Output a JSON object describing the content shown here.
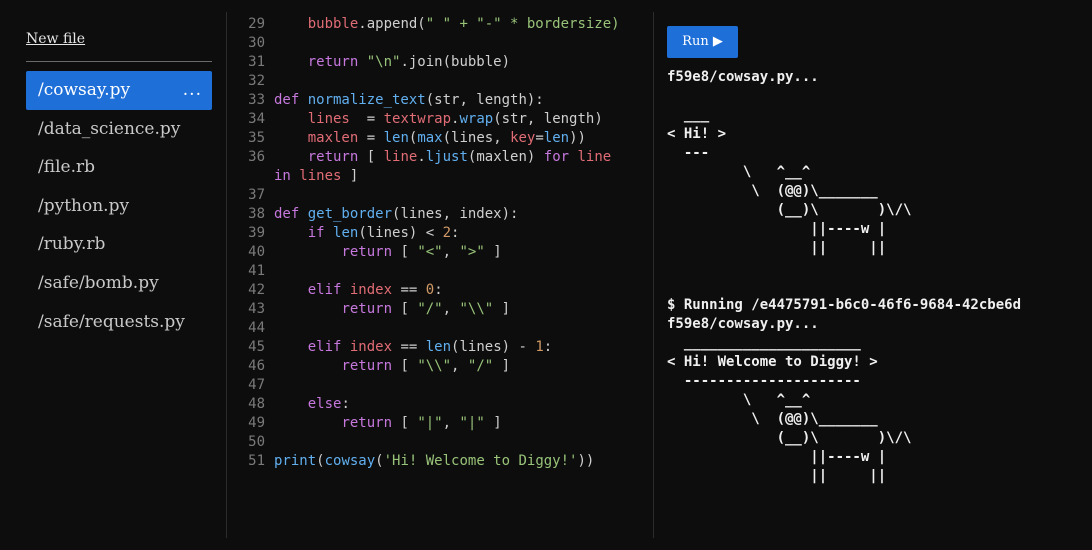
{
  "sidebar": {
    "new_file_label": "New file",
    "items": [
      {
        "label": "/cowsay.py",
        "active": true,
        "more": "..."
      },
      {
        "label": "/data_science.py"
      },
      {
        "label": "/file.rb"
      },
      {
        "label": "/python.py"
      },
      {
        "label": "/ruby.rb"
      },
      {
        "label": "/safe/bomb.py"
      },
      {
        "label": "/safe/requests.py"
      }
    ]
  },
  "editor": {
    "lines": [
      {
        "n": "29",
        "tokens": [
          [
            "    ",
            "op"
          ],
          [
            "bubble",
            "var"
          ],
          [
            ".append(",
            "op"
          ],
          [
            "\" \" + \"-\" * bordersize)",
            "str"
          ]
        ]
      },
      {
        "n": "30",
        "tokens": []
      },
      {
        "n": "31",
        "tokens": [
          [
            "    ",
            "op"
          ],
          [
            "return ",
            "kw"
          ],
          [
            "\"\\n\"",
            "str"
          ],
          [
            ".join(bubble)",
            "op"
          ]
        ]
      },
      {
        "n": "32",
        "tokens": []
      },
      {
        "n": "33",
        "tokens": [
          [
            "def ",
            "kw"
          ],
          [
            "normalize_text",
            "fn"
          ],
          [
            "(str, length):",
            "op"
          ]
        ]
      },
      {
        "n": "34",
        "tokens": [
          [
            "    ",
            "op"
          ],
          [
            "lines",
            "var"
          ],
          [
            "  = ",
            "op"
          ],
          [
            "textwrap",
            "var"
          ],
          [
            ".",
            "op"
          ],
          [
            "wrap",
            "fn"
          ],
          [
            "(str, length)",
            "op"
          ]
        ]
      },
      {
        "n": "35",
        "tokens": [
          [
            "    ",
            "op"
          ],
          [
            "maxlen",
            "var"
          ],
          [
            " = ",
            "op"
          ],
          [
            "len",
            "fn"
          ],
          [
            "(",
            "op"
          ],
          [
            "max",
            "fn"
          ],
          [
            "(lines, ",
            "op"
          ],
          [
            "key",
            "var"
          ],
          [
            "=",
            "op"
          ],
          [
            "len",
            "fn"
          ],
          [
            "))",
            "op"
          ]
        ]
      },
      {
        "n": "36",
        "tokens": [
          [
            "    ",
            "op"
          ],
          [
            "return ",
            "kw"
          ],
          [
            "[ ",
            "op"
          ],
          [
            "line",
            "var"
          ],
          [
            ".",
            "op"
          ],
          [
            "ljust",
            "fn"
          ],
          [
            "(maxlen) ",
            "op"
          ],
          [
            "for ",
            "kw"
          ],
          [
            "line",
            "var"
          ]
        ]
      },
      {
        "n": "",
        "tokens": [
          [
            "in ",
            "kw"
          ],
          [
            "lines",
            "var"
          ],
          [
            " ]",
            "op"
          ]
        ]
      },
      {
        "n": "37",
        "tokens": []
      },
      {
        "n": "38",
        "tokens": [
          [
            "def ",
            "kw"
          ],
          [
            "get_border",
            "fn"
          ],
          [
            "(lines, index):",
            "op"
          ]
        ]
      },
      {
        "n": "39",
        "tokens": [
          [
            "    ",
            "op"
          ],
          [
            "if ",
            "kw"
          ],
          [
            "len",
            "fn"
          ],
          [
            "(lines) < ",
            "op"
          ],
          [
            "2",
            "num"
          ],
          [
            ":",
            "op"
          ]
        ]
      },
      {
        "n": "40",
        "tokens": [
          [
            "        ",
            "op"
          ],
          [
            "return ",
            "kw"
          ],
          [
            "[ ",
            "op"
          ],
          [
            "\"<\"",
            "str"
          ],
          [
            ", ",
            "op"
          ],
          [
            "\">\"",
            "str"
          ],
          [
            " ]",
            "op"
          ]
        ]
      },
      {
        "n": "41",
        "tokens": []
      },
      {
        "n": "42",
        "tokens": [
          [
            "    ",
            "op"
          ],
          [
            "elif ",
            "kw"
          ],
          [
            "index",
            "var"
          ],
          [
            " == ",
            "op"
          ],
          [
            "0",
            "num"
          ],
          [
            ":",
            "op"
          ]
        ]
      },
      {
        "n": "43",
        "tokens": [
          [
            "        ",
            "op"
          ],
          [
            "return ",
            "kw"
          ],
          [
            "[ ",
            "op"
          ],
          [
            "\"/\"",
            "str"
          ],
          [
            ", ",
            "op"
          ],
          [
            "\"\\\\\"",
            "str"
          ],
          [
            " ]",
            "op"
          ]
        ]
      },
      {
        "n": "44",
        "tokens": []
      },
      {
        "n": "45",
        "tokens": [
          [
            "    ",
            "op"
          ],
          [
            "elif ",
            "kw"
          ],
          [
            "index",
            "var"
          ],
          [
            " == ",
            "op"
          ],
          [
            "len",
            "fn"
          ],
          [
            "(lines) - ",
            "op"
          ],
          [
            "1",
            "num"
          ],
          [
            ":",
            "op"
          ]
        ]
      },
      {
        "n": "46",
        "tokens": [
          [
            "        ",
            "op"
          ],
          [
            "return ",
            "kw"
          ],
          [
            "[ ",
            "op"
          ],
          [
            "\"\\\\\"",
            "str"
          ],
          [
            ", ",
            "op"
          ],
          [
            "\"/\"",
            "str"
          ],
          [
            " ]",
            "op"
          ]
        ]
      },
      {
        "n": "47",
        "tokens": []
      },
      {
        "n": "48",
        "tokens": [
          [
            "    ",
            "op"
          ],
          [
            "else",
            "kw"
          ],
          [
            ":",
            "op"
          ]
        ]
      },
      {
        "n": "49",
        "tokens": [
          [
            "        ",
            "op"
          ],
          [
            "return ",
            "kw"
          ],
          [
            "[ ",
            "op"
          ],
          [
            "\"|\"",
            "str"
          ],
          [
            ", ",
            "op"
          ],
          [
            "\"|\"",
            "str"
          ],
          [
            " ]",
            "op"
          ]
        ]
      },
      {
        "n": "50",
        "tokens": []
      },
      {
        "n": "51",
        "tokens": [
          [
            "print",
            "fn"
          ],
          [
            "(",
            "op"
          ],
          [
            "cowsay",
            "fn"
          ],
          [
            "(",
            "op"
          ],
          [
            "'Hi! Welcome to Diggy!'",
            "str"
          ],
          [
            "))",
            "op"
          ]
        ]
      }
    ]
  },
  "output": {
    "run_label": "Run ▶",
    "terminal_lines": [
      "f59e8/cowsay.py...",
      "",
      "  ___",
      "< Hi! >",
      "  ---",
      "         \\   ^__^",
      "          \\  (@@)\\_______",
      "             (__)\\       )\\/\\",
      "                 ||----w |",
      "                 ||     ||",
      "",
      "",
      "$ Running /e4475791-b6c0-46f6-9684-42cbe6d",
      "f59e8/cowsay.py...",
      "  _____________________",
      "< Hi! Welcome to Diggy! >",
      "  ---------------------",
      "         \\   ^__^",
      "          \\  (@@)\\_______",
      "             (__)\\       )\\/\\",
      "                 ||----w |",
      "                 ||     ||"
    ]
  }
}
